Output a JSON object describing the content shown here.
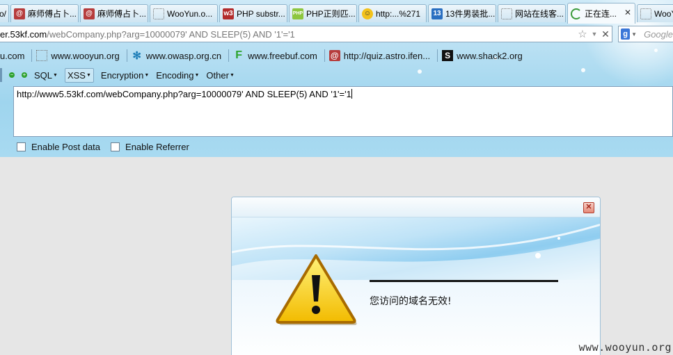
{
  "tabs": [
    {
      "label": "o/",
      "icon": "none"
    },
    {
      "label": "麻师傅占卜...",
      "icon": "swirl-icon"
    },
    {
      "label": "麻师傅占卜...",
      "icon": "swirl-icon"
    },
    {
      "label": "WooYun.o...",
      "icon": "blank-page-icon"
    },
    {
      "label": "PHP substr...",
      "icon": "w3-icon"
    },
    {
      "label": "PHP正则匹...",
      "icon": "php-icon"
    },
    {
      "label": "http:...%271",
      "icon": "smiley-icon"
    },
    {
      "label": "13件男装批...",
      "icon": "number-13-icon"
    },
    {
      "label": "网站在线客...",
      "icon": "blank-page-icon"
    },
    {
      "label": "正在连...",
      "icon": "loading-icon"
    },
    {
      "label": "WooY",
      "icon": "blank-page-icon"
    }
  ],
  "urlbar": {
    "domain_part": "er.53kf.com",
    "path_part": "/webCompany.php?arg=10000079' AND SLEEP(5) AND '1'='1"
  },
  "search": {
    "placeholder": "Google"
  },
  "bookmarks": [
    {
      "label": "u.com",
      "icon": "none"
    },
    {
      "label": "www.wooyun.org",
      "icon": "blank-page-icon"
    },
    {
      "label": "www.owasp.org.cn",
      "icon": "owasp-icon"
    },
    {
      "label": "www.freebuf.com",
      "icon": "freebuf-icon"
    },
    {
      "label": "http://quiz.astro.ifen...",
      "icon": "swirl-icon"
    },
    {
      "label": "www.shack2.org",
      "icon": "shack2-icon"
    }
  ],
  "hackbar": {
    "menus": [
      "SQL",
      "XSS",
      "Encryption",
      "Encoding",
      "Other"
    ],
    "url_value": "http://www5.53kf.com/webCompany.php?arg=10000079' AND SLEEP(5) AND '1'='1",
    "enable_post": "Enable Post data",
    "enable_referrer": "Enable Referrer"
  },
  "dialog": {
    "message": "您访问的域名无效!"
  },
  "watermark": "www.wooyun.org",
  "colors": {
    "toolbar_bg": "#a8daf1",
    "dialog_banner": "#8fcdf0",
    "warning_yellow": "#f5c800"
  }
}
